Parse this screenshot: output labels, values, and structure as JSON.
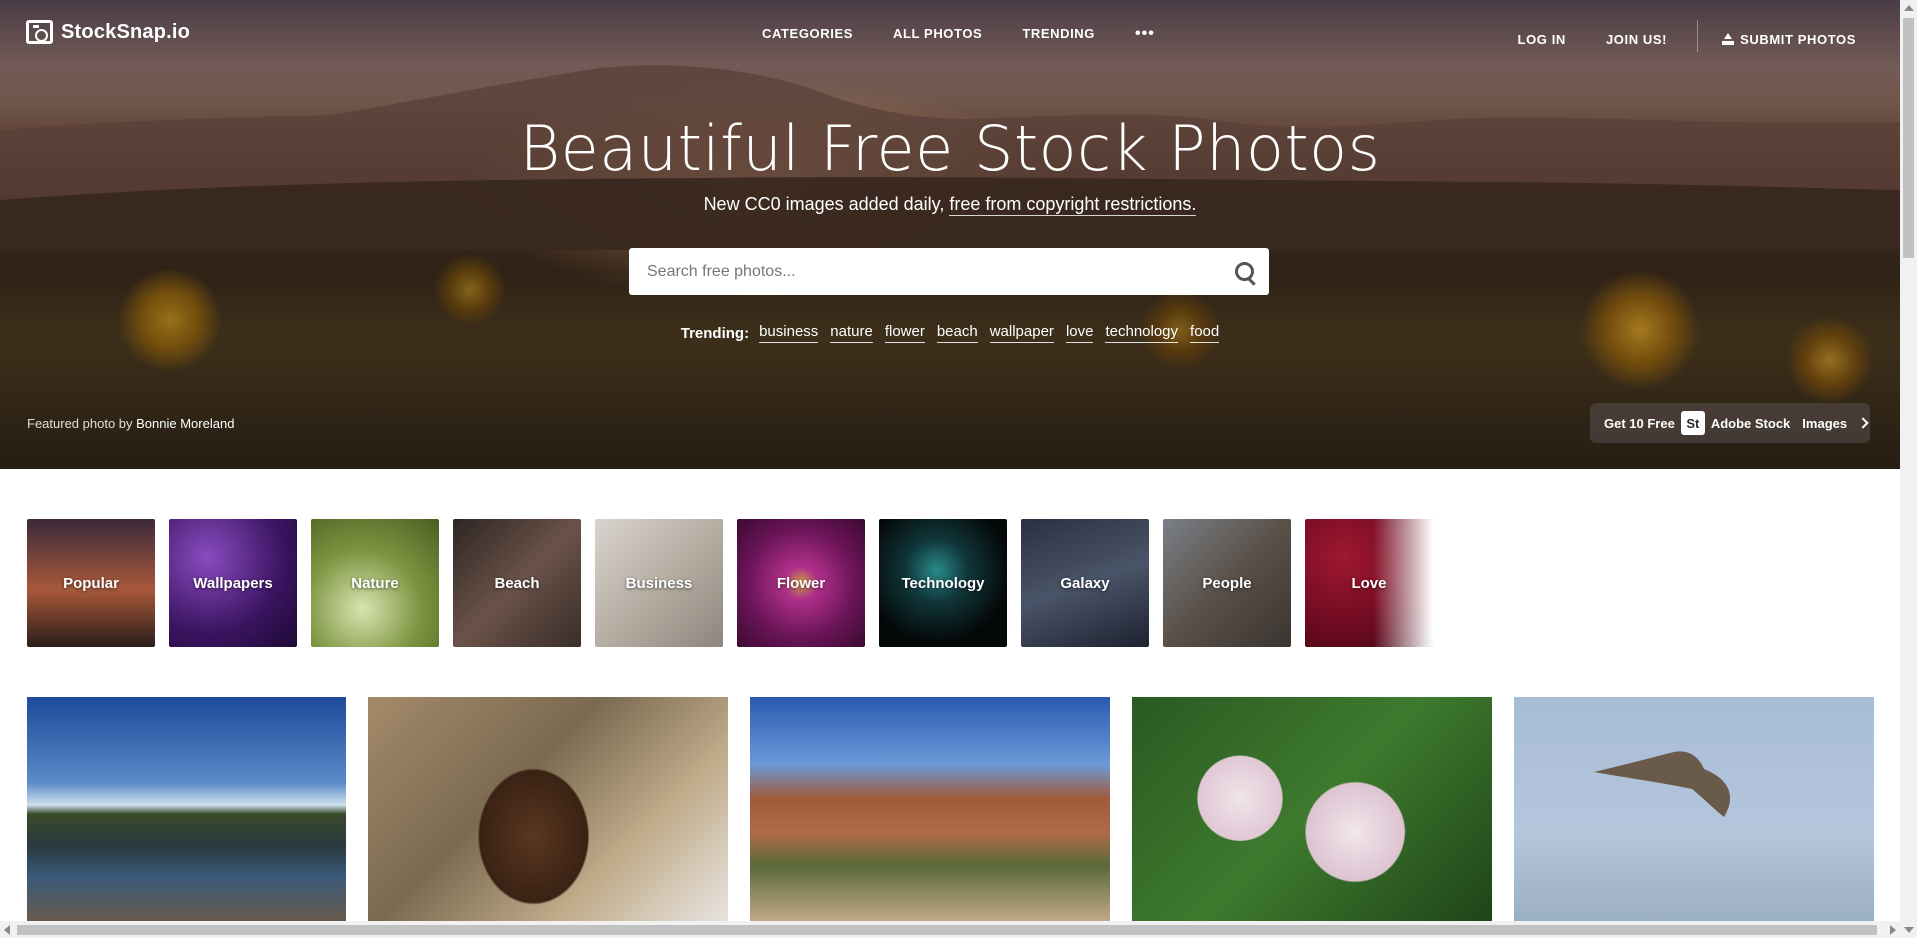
{
  "brand": {
    "name": "StockSnap.io"
  },
  "nav": {
    "center": [
      "CATEGORIES",
      "ALL PHOTOS",
      "TRENDING"
    ],
    "more": "•••",
    "login": "LOG IN",
    "join": "JOIN US!",
    "submit": "SUBMIT PHOTOS"
  },
  "hero": {
    "title": "Beautiful Free Stock Photos",
    "subtitle_prefix": "New CC0 images added daily, ",
    "subtitle_link": "free from copyright restrictions.",
    "search_placeholder": "Search free photos...",
    "trending_label": "Trending:",
    "trending_tags": [
      "business",
      "nature",
      "flower",
      "beach",
      "wallpaper",
      "love",
      "technology",
      "food"
    ],
    "featured_prefix": "Featured photo by ",
    "featured_author": "Bonnie Moreland"
  },
  "adobe": {
    "prefix": "Get 10 Free",
    "badge": "St",
    "brand": "Adobe Stock",
    "suffix": "Images"
  },
  "categories": [
    "Popular",
    "Wallpapers",
    "Nature",
    "Beach",
    "Business",
    "Flower",
    "Technology",
    "Galaxy",
    "People",
    "Love"
  ],
  "colors": {
    "accent_white": "#ffffff",
    "search_bg": "#ffffff",
    "page_bg": "#ffffff"
  }
}
